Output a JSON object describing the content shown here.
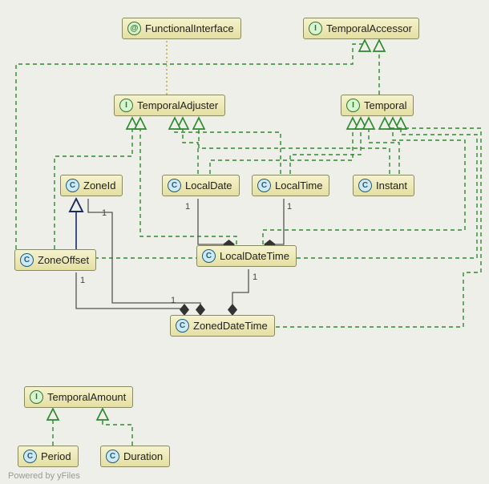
{
  "footer": "Powered by yFiles",
  "icons": {
    "interface": "I",
    "class": "C",
    "annotation": "@"
  },
  "nodes": {
    "functionalInterface": {
      "label": "FunctionalInterface",
      "kind": "annotation"
    },
    "temporalAccessor": {
      "label": "TemporalAccessor",
      "kind": "interface"
    },
    "temporalAdjuster": {
      "label": "TemporalAdjuster",
      "kind": "interface"
    },
    "temporal": {
      "label": "Temporal",
      "kind": "interface"
    },
    "zoneId": {
      "label": "ZoneId",
      "kind": "class"
    },
    "localDate": {
      "label": "LocalDate",
      "kind": "class"
    },
    "localTime": {
      "label": "LocalTime",
      "kind": "class"
    },
    "instant": {
      "label": "Instant",
      "kind": "class"
    },
    "zoneOffset": {
      "label": "ZoneOffset",
      "kind": "class"
    },
    "localDateTime": {
      "label": "LocalDateTime",
      "kind": "class"
    },
    "zonedDateTime": {
      "label": "ZonedDateTime",
      "kind": "class"
    },
    "temporalAmount": {
      "label": "TemporalAmount",
      "kind": "interface"
    },
    "period": {
      "label": "Period",
      "kind": "class"
    },
    "duration": {
      "label": "Duration",
      "kind": "class"
    }
  },
  "multiplicities": {
    "m1": "1",
    "m2": "1",
    "m3": "1",
    "m4": "1",
    "m5": "1",
    "m6": "1"
  }
}
